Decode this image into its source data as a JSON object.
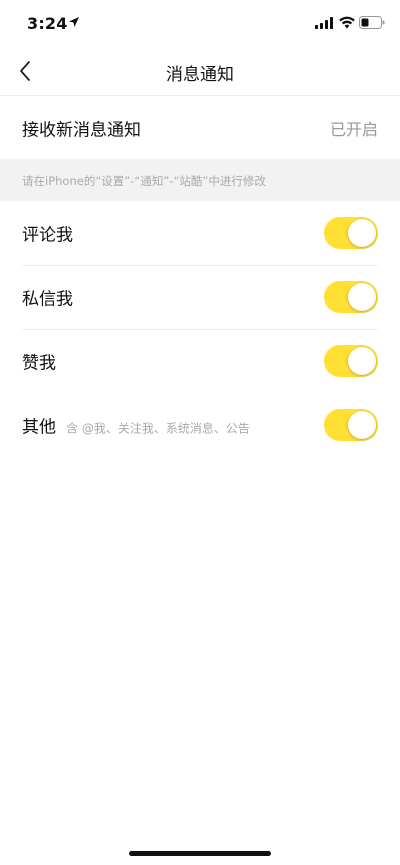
{
  "status_bar": {
    "time": "3:24"
  },
  "nav": {
    "title": "消息通知"
  },
  "receive": {
    "label": "接收新消息通知",
    "value": "已开启"
  },
  "hint": "请在iPhone的“设置”-“通知”-“站酷”中进行修改",
  "toggles": [
    {
      "label": "评论我",
      "sub": "",
      "on": true
    },
    {
      "label": "私信我",
      "sub": "",
      "on": true
    },
    {
      "label": "赞我",
      "sub": "",
      "on": true
    },
    {
      "label": "其他",
      "sub": "含 @我、关注我、系统消息、公告",
      "on": true
    }
  ],
  "colors": {
    "accent": "#ffe033",
    "muted": "#999999",
    "band": "#f2f2f2"
  }
}
